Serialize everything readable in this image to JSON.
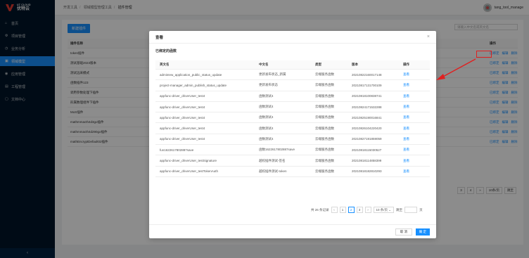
{
  "brand": {
    "en": "UT CLOUD",
    "cn": "优特云"
  },
  "sidebar": {
    "items": [
      {
        "label": "首页",
        "icon": "home-icon",
        "glyph": "⌂"
      },
      {
        "label": "项目管理",
        "icon": "project-icon",
        "glyph": "⚙"
      },
      {
        "label": "业务分析",
        "icon": "analysis-icon",
        "glyph": "◷"
      },
      {
        "label": "领域模型",
        "icon": "domain-model-icon",
        "glyph": "▣"
      },
      {
        "label": "应用管理",
        "icon": "app-icon",
        "glyph": "◉"
      },
      {
        "label": "工程管理",
        "icon": "engineering-icon",
        "glyph": "▤"
      },
      {
        "label": "文档中心",
        "icon": "docs-icon",
        "glyph": "▢"
      }
    ],
    "active_index": 3,
    "collapse_glyph": "‹"
  },
  "header": {
    "breadcrumb": [
      "开发工具",
      "领域模型管理工具",
      "插件管理"
    ],
    "user_name": "tang_tool_manage"
  },
  "background": {
    "new_button": "新建插件",
    "search_placeholder": "请输入中文名或英文名",
    "column_name": "插件名称",
    "column_ops": "操作",
    "rows": [
      "token插件",
      "测试基础2023版本",
      "测试远采模式",
      "函数插件123",
      "调用参数处理下插件",
      "形属数理组件下插件",
      "MoS插件",
      "mathmmacth4d3go插件",
      "mathmmacth4d290go插件",
      "mathEncryptDefault02插件"
    ],
    "row_ops": [
      "已绑定",
      "编辑",
      "删除"
    ],
    "pager": [
      "3",
      "4",
      "»",
      "10条/页",
      "跳至"
    ]
  },
  "modal": {
    "title": "查看",
    "section_title": "已绑定的函数",
    "columns": {
      "en": "英文名",
      "cn": "中文名",
      "type": "类型",
      "version": "版本",
      "op": "操作"
    },
    "rows": [
      {
        "en": "adminIew_application_public_status_update",
        "cn": "更新发布状态_新属",
        "type": "云端服务函数",
        "version": "20210822160017148",
        "op": "查看"
      },
      {
        "en": "project-manager_admin_publish_status_update",
        "cn": "更新发布状态",
        "type": "云端服务函数",
        "version": "20210817131700109",
        "op": "查看"
      },
      {
        "en": "appfunc-driver_driverUser_test4",
        "cn": "函数测试4",
        "type": "云端服务函数",
        "version": "20210818100838741",
        "op": "查看"
      },
      {
        "en": "appfunc-driver_driverUser_test4",
        "cn": "函数测试4",
        "type": "云端服务函数",
        "version": "20210824171532288",
        "op": "查看"
      },
      {
        "en": "appfunc-driver_driverUser_test4",
        "cn": "函数测试4",
        "type": "云端服务函数",
        "version": "20210825190016841",
        "op": "查看"
      },
      {
        "en": "appfunc-driver_driverUser_test4",
        "cn": "函数测试4",
        "type": "云端服务函数",
        "version": "20210826104220420",
        "op": "查看"
      },
      {
        "en": "appfunc-driver_driverUser_test4",
        "cn": "函数测试4",
        "type": "云端服务函数",
        "version": "20210827191859059",
        "op": "查看"
      },
      {
        "en": "fun1622617802887save",
        "cn": "函数1622617802887save",
        "type": "云端服务函数",
        "version": "20210818115030527",
        "op": "查看"
      },
      {
        "en": "appfunc-driver_driverUser_testSignature",
        "cn": "越权插件测试-签名",
        "type": "云端服务函数",
        "version": "20210818114858399",
        "op": "查看"
      },
      {
        "en": "appfunc-driver_driverUser_testTokenAuth",
        "cn": "越权插件测试-token",
        "type": "云端服务函数",
        "version": "20210818182810293",
        "op": "查看"
      }
    ],
    "pager": {
      "total": "共 26 条记录",
      "prev": "‹",
      "pages": [
        "1",
        "2",
        "3"
      ],
      "current": "2",
      "next": "›",
      "size": "10 条/页",
      "jump_label": "跳至",
      "jump_suffix": "页"
    },
    "cancel": "取 消",
    "ok": "确 定",
    "close_glyph": "×"
  },
  "colors": {
    "primary": "#1890ff",
    "sidebar_bg": "#001529",
    "annotation": "#e02020"
  }
}
